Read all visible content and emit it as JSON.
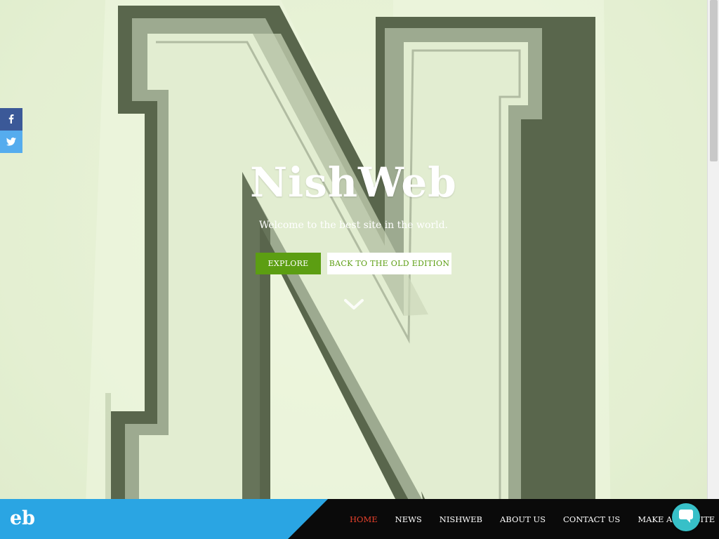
{
  "site": {
    "title": "NishWeb",
    "tagline": "Welcome to the best site in the world.",
    "logo_text": "eb"
  },
  "hero": {
    "explore_label": "EXPLORE",
    "old_edition_label": "BACK TO THE OLD EDITION"
  },
  "social": {
    "items": [
      {
        "name": "facebook",
        "icon": "facebook-icon",
        "color": "#3b5998"
      },
      {
        "name": "twitter",
        "icon": "twitter-icon",
        "color": "#55acee"
      }
    ]
  },
  "nav": {
    "items": [
      {
        "label": "HOME",
        "active": true
      },
      {
        "label": "NEWS",
        "active": false
      },
      {
        "label": "NISHWEB",
        "active": false
      },
      {
        "label": "ABOUT US",
        "active": false
      },
      {
        "label": "CONTACT US",
        "active": false
      },
      {
        "label": "MAKE A WEBSITE",
        "active": false
      }
    ]
  },
  "colors": {
    "accent_green": "#5c9e12",
    "brand_blue": "#2aa5e3",
    "active_nav": "#e8412c",
    "chat_teal": "#37c0c8",
    "navbar_bg": "#0a0a0a"
  }
}
